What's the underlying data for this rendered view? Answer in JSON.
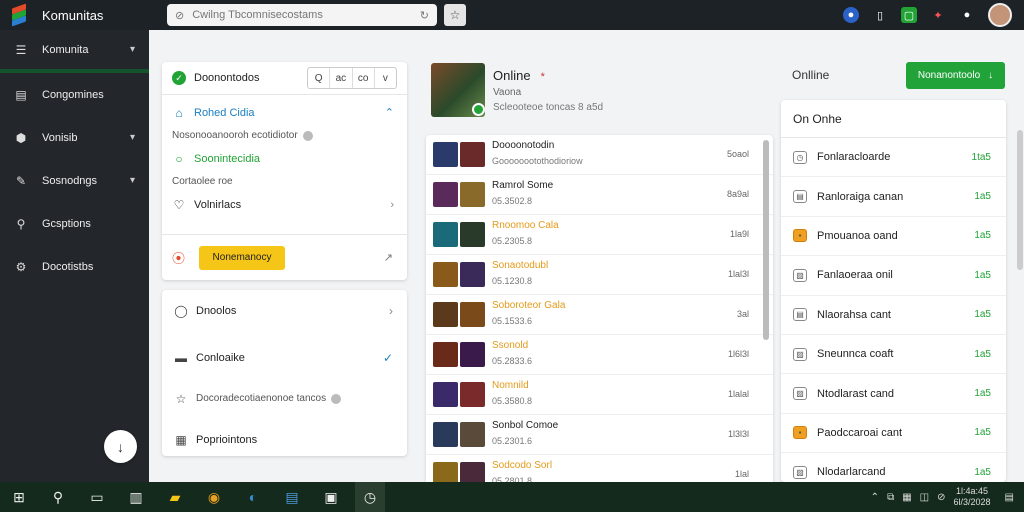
{
  "app": {
    "title": "Komunitas"
  },
  "url": {
    "text": "Cwilng Tbcomnisecostams"
  },
  "sidebar": {
    "items": [
      {
        "label": "Komunita",
        "icon": "list-icon",
        "chevron": true,
        "active": true
      },
      {
        "label": "Congomines",
        "icon": "table-icon",
        "chevron": false
      },
      {
        "label": "Vonisib",
        "icon": "shield-icon",
        "chevron": true
      },
      {
        "label": "Sosnodngs",
        "icon": "pencil-icon",
        "chevron": true
      },
      {
        "label": "Gcsptions",
        "icon": "person-icon",
        "chevron": false
      },
      {
        "label": "Docotistbs",
        "icon": "gear-icon",
        "chevron": false
      }
    ]
  },
  "panel_left": {
    "header_title": "Doonontodos",
    "seg": [
      "Q",
      "ac",
      "co",
      "v"
    ],
    "rows": [
      {
        "label": "Rohed Cidia",
        "icon": "home-icon",
        "color": "#1a7fbf",
        "right": "^"
      },
      {
        "label": "Nosonooanooroh ecotidiotor",
        "icon": "",
        "color": "#555",
        "right": "",
        "dot": true
      },
      {
        "label": "Soonintecidia",
        "icon": "circle-icon",
        "color": "#21a336",
        "right": ""
      },
      {
        "label": "Cortaolee roe",
        "icon": "",
        "color": "#555",
        "right": ""
      },
      {
        "label": "Volnirlacs",
        "icon": "heart-icon",
        "color": "#222",
        "right": ">"
      }
    ],
    "footer_button": "Nonemanocy",
    "footer_arrow": "↗"
  },
  "panel_left2": {
    "rows": [
      {
        "label": "Dnoolos",
        "icon": "chat-icon",
        "right": ">",
        "right_color": "#888"
      },
      {
        "label": "Conloaike",
        "icon": "menu-icon",
        "right": "✓",
        "right_color": "#1a7fbf"
      },
      {
        "label": "Docoradecotiaenonoe tancos",
        "icon": "star-icon",
        "right": "",
        "dot": true
      },
      {
        "label": "Popriointons",
        "icon": "calendar-icon",
        "right": ""
      }
    ]
  },
  "profile": {
    "name": "Online",
    "status": "Vaona",
    "sub": "Scleooteoe toncas  8 a5d"
  },
  "games": [
    {
      "name": "Doooonotodin",
      "name_color": "#222",
      "sub": "Goooooootothodioriow",
      "time": "5oaol",
      "thumbs": [
        "#2a3a6a",
        "#6a2a2a"
      ]
    },
    {
      "name": "Ramrol Some",
      "name_color": "#222",
      "sub": "05.3502.8",
      "time": "8a9al",
      "thumbs": [
        "#5a2a5a",
        "#8a6a2a"
      ]
    },
    {
      "name": "Rnoomoo Cala",
      "name_color": "#e39a1a",
      "sub": "05.2305.8",
      "time": "1la9l",
      "thumbs": [
        "#1a6a7a",
        "#2a3a2a"
      ]
    },
    {
      "name": "Sonaotodubl",
      "name_color": "#e39a1a",
      "sub": "05.1230.8",
      "time": "1lal3l",
      "thumbs": [
        "#8a5a1a",
        "#3a2a5a"
      ]
    },
    {
      "name": "Soboroteor Gala",
      "name_color": "#e39a1a",
      "sub": "05.1533.6",
      "time": "3al",
      "thumbs": [
        "#5a3a1a",
        "#7a4a1a"
      ]
    },
    {
      "name": "Ssonold",
      "name_color": "#e39a1a",
      "sub": "05.2833.6",
      "time": "1l6l3l",
      "thumbs": [
        "#6a2a1a",
        "#3a1a4a"
      ]
    },
    {
      "name": "Nomnild",
      "name_color": "#e39a1a",
      "sub": "05.3580.8",
      "time": "1lalal",
      "thumbs": [
        "#3a2a6a",
        "#7a2a2a"
      ]
    },
    {
      "name": "Sonbol Comoe",
      "name_color": "#222",
      "sub": "05.2301.6",
      "time": "1l3l3l",
      "thumbs": [
        "#2a3a5a",
        "#5a4a3a"
      ]
    },
    {
      "name": "Sodcodo Sorl",
      "name_color": "#e39a1a",
      "sub": "05.2801.8",
      "time": "1lal",
      "thumbs": [
        "#8a6a1a",
        "#4a2a3a"
      ]
    }
  ],
  "friends_header": {
    "online_label": "Onlline",
    "button_label": "Nonanontoolo"
  },
  "friends": {
    "title": "On Onhe",
    "rows": [
      {
        "name": "Fonlaracloarde",
        "status": "1ta5",
        "icon": "clock-icon",
        "orange": false
      },
      {
        "name": "Ranloraiga canan",
        "status": "1a5",
        "icon": "table-icon",
        "orange": false
      },
      {
        "name": "Pmouanoa oand",
        "status": "1a5",
        "icon": "tag-icon",
        "orange": true
      },
      {
        "name": "Fanlaoeraa onil",
        "status": "1a5",
        "icon": "image-icon",
        "orange": false
      },
      {
        "name": "Nlaorahsa cant",
        "status": "1a5",
        "icon": "table-icon",
        "orange": false
      },
      {
        "name": "Sneunnca coaft",
        "status": "1a5",
        "icon": "image-icon",
        "orange": false
      },
      {
        "name": "Ntodlarast cand",
        "status": "1a5",
        "icon": "image-icon",
        "orange": false
      },
      {
        "name": "Paodccaroai cant",
        "status": "1a5",
        "icon": "tag-icon",
        "orange": true
      },
      {
        "name": "Nlodarlarcand",
        "status": "1a5",
        "icon": "image-icon",
        "orange": false
      }
    ]
  },
  "taskbar": {
    "clock_time": "1l:4a:45",
    "clock_date": "6l/3/2028"
  }
}
